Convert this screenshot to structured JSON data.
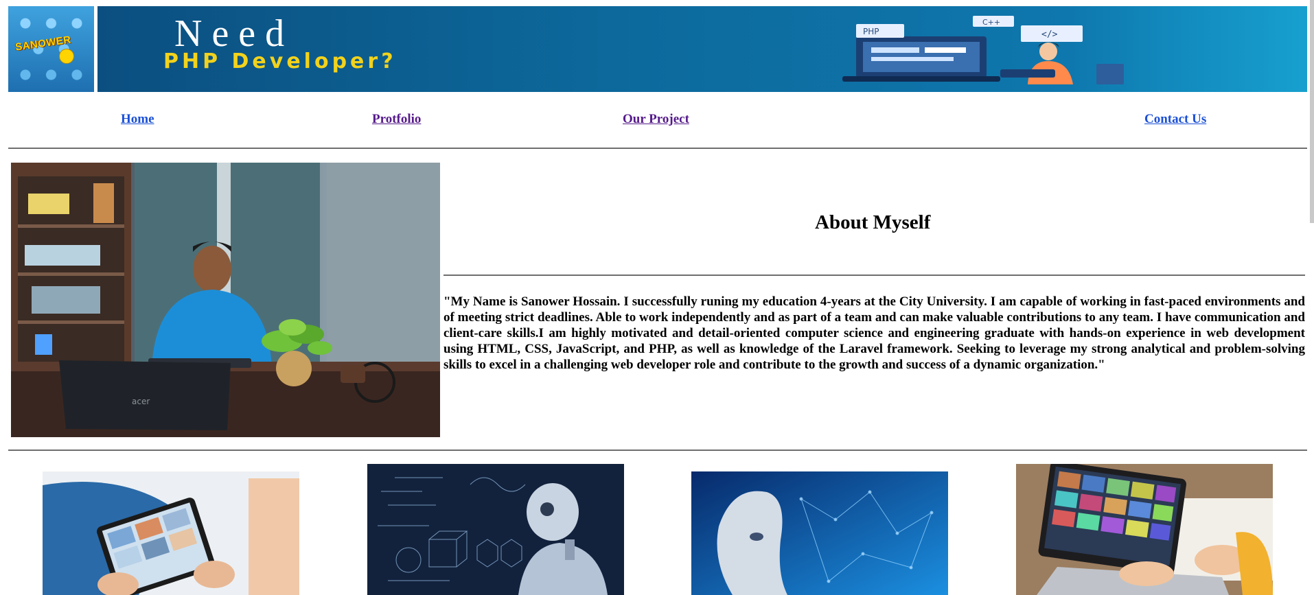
{
  "header": {
    "logo_text": "SANOWER",
    "banner_line1": "Need",
    "banner_line2": "PHP Developer?",
    "banner_tags": [
      "PHP",
      "C++",
      "</>"
    ]
  },
  "nav": {
    "home": "Home",
    "portfolio": "Protfolio",
    "project": "Our Project",
    "contact": "Contact Us"
  },
  "about": {
    "title": "About Myself",
    "text": "\"My Name is Sanower Hossain. I successfully runing my education 4-years at the City University. I am capable of working in fast-paced environments and of meeting strict deadlines. Able to work independently and as part of a team and can make valuable contributions to any team. I have communication and client-care skills.I am highly motivated and detail-oriented computer science and engineering graduate with hands-on experience in web development using HTML, CSS, JavaScript, and PHP, as well as knowledge of the Laravel framework. Seeking to leverage my strong analytical and problem-solving skills to excel in a challenging web developer role and contribute to the growth and success of a dynamic organization.\"",
    "laptop_brand": "acer"
  },
  "colors": {
    "visited_link": "#551a8b",
    "link": "#1a4fd6",
    "banner_blue": "#0d6a9d",
    "banner_yellow": "#f2d21c"
  }
}
